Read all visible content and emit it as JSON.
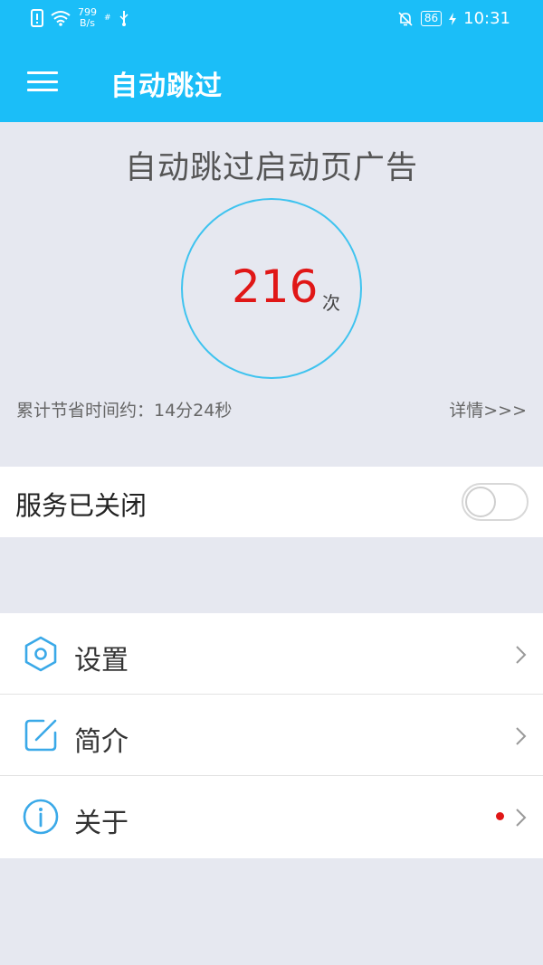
{
  "status_bar": {
    "net_speed_value": "799",
    "net_speed_unit": "B/s",
    "carrier_hint": "#",
    "battery": "86",
    "time": "10:31"
  },
  "app_bar": {
    "title": "自动跳过",
    "menu_icon": "hamburger-menu-icon"
  },
  "stats": {
    "headline": "自动跳过启动页广告",
    "count": "216",
    "count_unit": "次",
    "saved_time": "累计节省时间约：14分24秒",
    "details_link": "详情>>>"
  },
  "service": {
    "label": "服务已关闭",
    "enabled": false
  },
  "menu": {
    "items": [
      {
        "label": "设置",
        "icon": "hexagon-settings-icon",
        "badge": false
      },
      {
        "label": "简介",
        "icon": "edit-square-icon",
        "badge": false
      },
      {
        "label": "关于",
        "icon": "info-circle-icon",
        "badge": true
      }
    ]
  },
  "colors": {
    "primary": "#1bbef8",
    "background": "#e6e8f0",
    "count_red": "#e01717",
    "icon_blue": "#3aa9e8"
  }
}
